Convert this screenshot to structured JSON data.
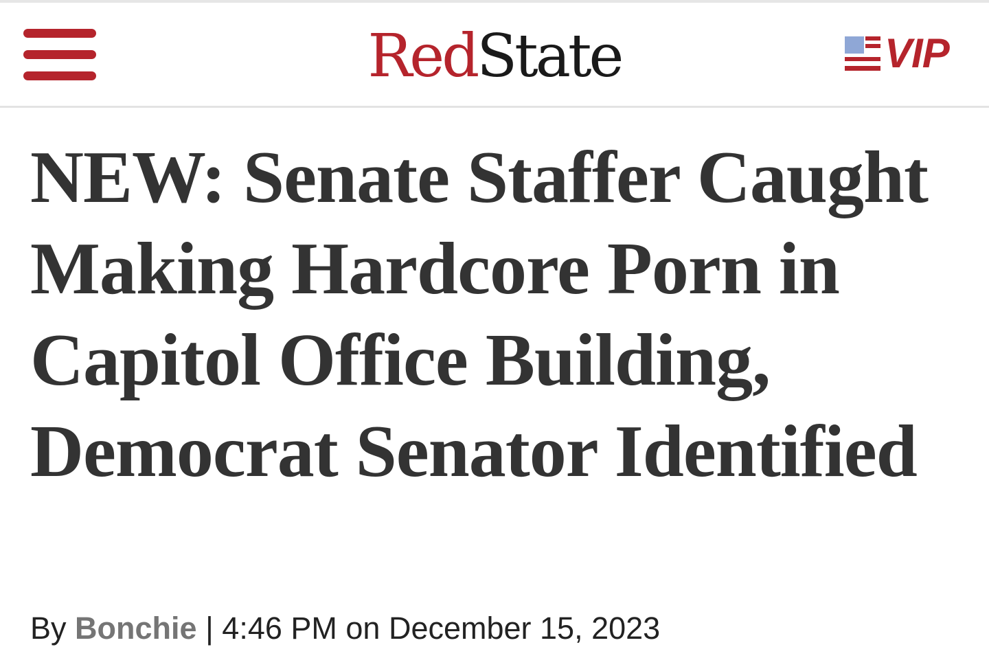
{
  "header": {
    "menu_icon": "hamburger-menu-icon",
    "logo_part1": "Red",
    "logo_part2": "State",
    "vip_label": "VIP",
    "vip_icon": "us-flag-icon",
    "colors": {
      "brand_red": "#b5242c",
      "flag_blue": "#8fa7d6"
    }
  },
  "article": {
    "headline": "NEW: Senate Staffer Caught Making Hardcore Porn in Capitol Office Building, Democrat Senator Identified",
    "byline_prefix": "By",
    "author": "Bonchie",
    "separator": "|",
    "time": "4:46 PM on December 15, 2023"
  }
}
